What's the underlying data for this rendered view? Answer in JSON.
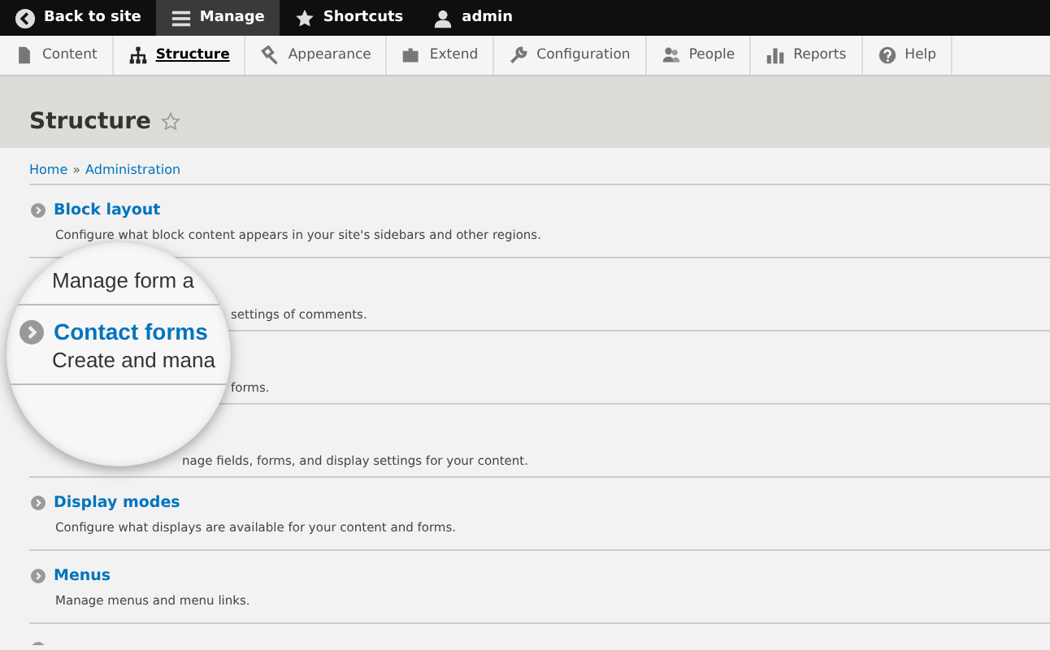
{
  "toolbar": [
    {
      "label": "Back to site",
      "selected": false
    },
    {
      "label": "Manage",
      "selected": true
    },
    {
      "label": "Shortcuts",
      "selected": false
    },
    {
      "label": "admin",
      "selected": false
    }
  ],
  "tabs": [
    {
      "label": "Content",
      "selected": false
    },
    {
      "label": "Structure",
      "selected": true
    },
    {
      "label": "Appearance",
      "selected": false
    },
    {
      "label": "Extend",
      "selected": false
    },
    {
      "label": "Configuration",
      "selected": false
    },
    {
      "label": "People",
      "selected": false
    },
    {
      "label": "Reports",
      "selected": false
    },
    {
      "label": "Help",
      "selected": false
    }
  ],
  "page_title": "Structure",
  "breadcrumb": [
    "Home",
    "Administration"
  ],
  "breadcrumb_separator": "»",
  "items": [
    {
      "kind": "full",
      "title": "Block layout",
      "description": "Configure what block content appears in your site's sidebars and other regions."
    },
    {
      "kind": "covered",
      "description": "settings of comments."
    },
    {
      "kind": "covered",
      "description": "forms."
    },
    {
      "kind": "covered-low",
      "description": "nage fields, forms, and display settings for your content."
    },
    {
      "kind": "full",
      "title": "Display modes",
      "description": "Configure what displays are available for your content and forms."
    },
    {
      "kind": "full",
      "title": "Menus",
      "description": "Manage menus and menu links."
    },
    {
      "kind": "stub"
    }
  ],
  "magnifier": {
    "lines": [
      {
        "kind": "description",
        "text": "Manage form a"
      },
      {
        "kind": "title",
        "text": "Contact forms"
      },
      {
        "kind": "description",
        "text": "Create and mana"
      }
    ]
  }
}
